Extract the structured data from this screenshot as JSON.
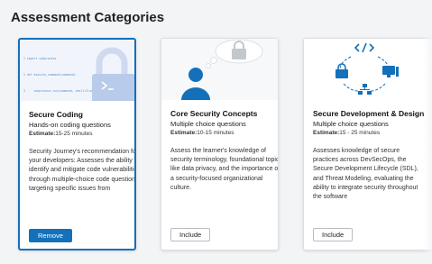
{
  "page": {
    "title": "Assessment Categories"
  },
  "colors": {
    "accent": "#1470b9"
  },
  "cards": [
    {
      "name": "Secure Coding",
      "question_type": "Hands-on coding questions",
      "estimate_label": "Estimate:",
      "estimate_value": "15-25 minutes",
      "description": "Security Journey's recommendation for your developers: Assesses the ability to identify and mitigate code vulnerabilities through multiple-choice code questions targeting specific issues from",
      "button_label": "Remove",
      "selected": true,
      "image_icons": [
        "code-snippet",
        "lock-icon",
        "terminal-icon"
      ],
      "code_lines": [
        "1 import subprocess",
        "2 def execute_command(command):",
        "3     subprocess.run(command, shell=True)"
      ]
    },
    {
      "name": "Core Security Concepts",
      "question_type": "Multiple choice questions",
      "estimate_label": "Estimate:",
      "estimate_value": "10-15 minutes",
      "description": "Assess the learner's knowledge of security terminology, foundational topics like data privacy, and the importance of a security-focused organizational culture.",
      "button_label": "Include",
      "selected": false,
      "image_icons": [
        "person-icon",
        "thought-bubble-icon",
        "lock-icon"
      ]
    },
    {
      "name": "Secure Development & Design",
      "question_type": "Multiple choice questions",
      "estimate_label": "Estimate:",
      "estimate_value": "15 - 25 minutes",
      "description": "Assesses knowledge of secure practices across DevSecOps, the Secure Development Lifecycle (SDL), and Threat Modeling, evaluating the ability to integrate security throughout the software",
      "button_label": "Include",
      "selected": false,
      "image_icons": [
        "code-brackets-icon",
        "lock-icon",
        "computer-icon",
        "network-icon",
        "cycle-arrows-icon"
      ]
    }
  ]
}
